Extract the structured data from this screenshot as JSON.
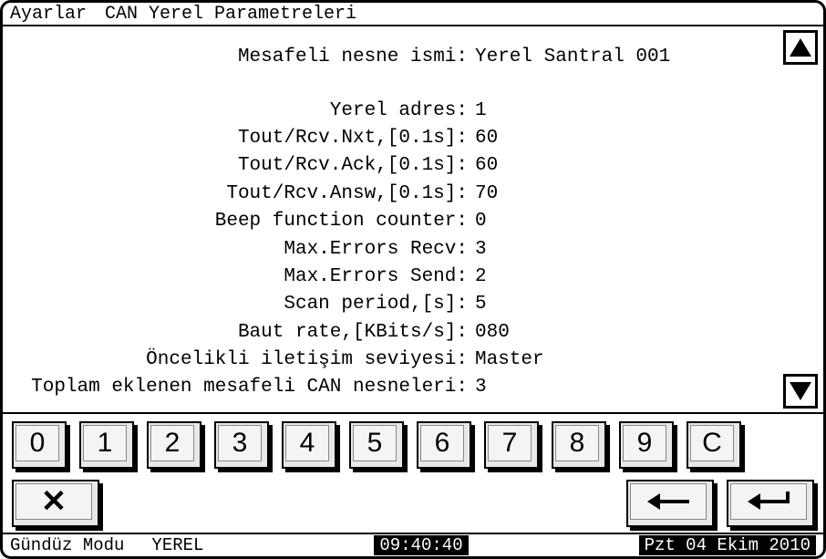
{
  "titlebar": {
    "menu": "Ayarlar",
    "title": "CAN Yerel Parametreleri"
  },
  "params": [
    {
      "label": "Mesafeli nesne ismi:",
      "value": "Yerel Santral 001"
    },
    {
      "label": "Yerel adres:",
      "value": "1"
    },
    {
      "label": "Tout/Rcv.Nxt,[0.1s]:",
      "value": "60"
    },
    {
      "label": "Tout/Rcv.Ack,[0.1s]:",
      "value": "60"
    },
    {
      "label": "Tout/Rcv.Answ,[0.1s]:",
      "value": "70"
    },
    {
      "label": "Beep function counter:",
      "value": "0"
    },
    {
      "label": "Max.Errors Recv:",
      "value": "3"
    },
    {
      "label": "Max.Errors Send:",
      "value": "2"
    },
    {
      "label": "Scan period,[s]:",
      "value": "5"
    },
    {
      "label": "Baut rate,[KBits/s]:",
      "value": "080"
    },
    {
      "label": "Öncelikli iletişim seviyesi:",
      "value": "Master"
    },
    {
      "label": "Toplam eklenen mesafeli CAN nesneleri:",
      "value": "3"
    }
  ],
  "keypad": {
    "digits": [
      "0",
      "1",
      "2",
      "3",
      "4",
      "5",
      "6",
      "7",
      "8",
      "9",
      "C"
    ],
    "cancel": "✕"
  },
  "statusbar": {
    "mode": "Gündüz Modu",
    "local": "YEREL",
    "time": "09:40:40",
    "date": "Pzt 04 Ekim 2010"
  }
}
